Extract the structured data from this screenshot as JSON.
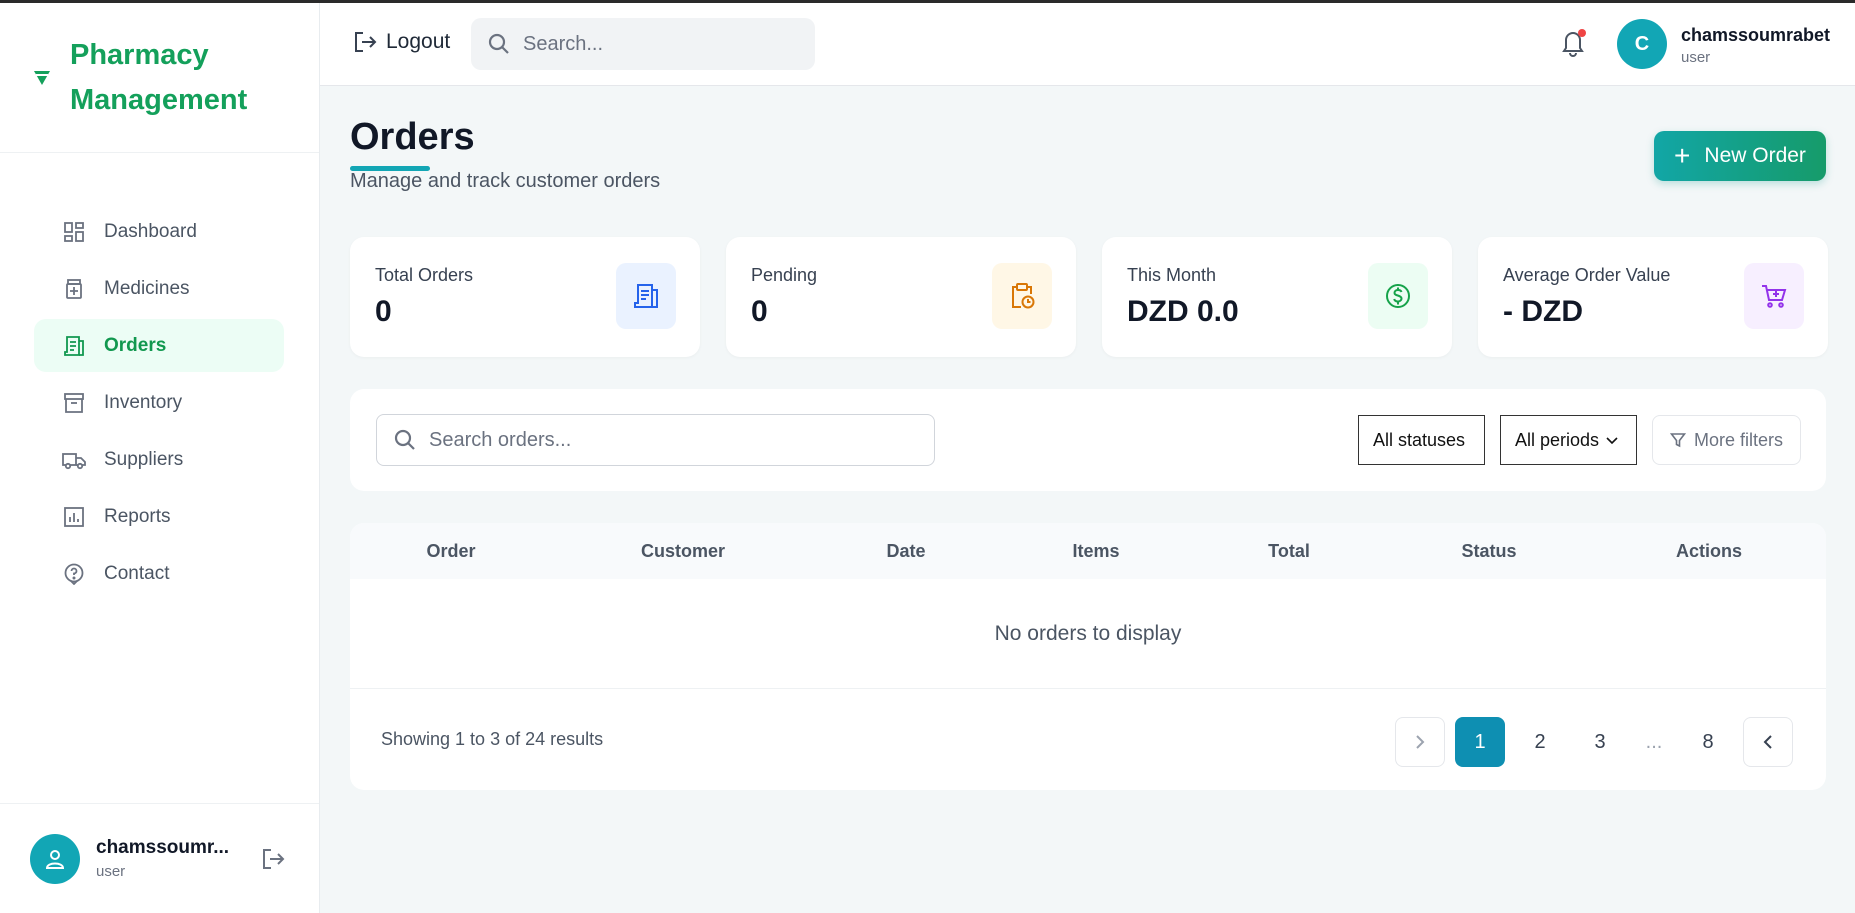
{
  "app": {
    "brand": "Pharmacy Management"
  },
  "sidebar": {
    "items": [
      {
        "label": "Dashboard",
        "icon": "dashboard-icon"
      },
      {
        "label": "Medicines",
        "icon": "medicine-icon"
      },
      {
        "label": "Orders",
        "icon": "receipt-icon",
        "active": true
      },
      {
        "label": "Inventory",
        "icon": "archive-icon"
      },
      {
        "label": "Suppliers",
        "icon": "truck-icon"
      },
      {
        "label": "Reports",
        "icon": "chart-icon"
      },
      {
        "label": "Contact",
        "icon": "help-icon"
      }
    ],
    "footer": {
      "name": "chamssoumr...",
      "role": "user"
    }
  },
  "header": {
    "logout_label": "Logout",
    "search_placeholder": "Search...",
    "avatar_initial": "C",
    "user_name": "chamssoumrabet",
    "user_role": "user"
  },
  "page": {
    "title": "Orders",
    "subtitle": "Manage and track customer orders",
    "new_order_label": "New Order"
  },
  "stats": [
    {
      "label": "Total Orders",
      "value": "0",
      "icon": "receipt-icon",
      "bg": "#eaf2ff",
      "fg": "#2563eb"
    },
    {
      "label": "Pending",
      "value": "0",
      "icon": "clipboard-clock-icon",
      "bg": "#fff7e6",
      "fg": "#d97706"
    },
    {
      "label": "This Month",
      "value": "DZD 0.0",
      "icon": "dollar-icon",
      "bg": "#ecfdf3",
      "fg": "#16a34a"
    },
    {
      "label": "Average Order Value",
      "value": "- DZD",
      "icon": "cart-icon",
      "bg": "#f7efff",
      "fg": "#9333ea"
    }
  ],
  "filters": {
    "search_placeholder": "Search orders...",
    "status_value": "All statuses",
    "period_value": "All periods",
    "more_filters_label": "More filters"
  },
  "table": {
    "columns": [
      "Order",
      "Customer",
      "Date",
      "Items",
      "Total",
      "Status",
      "Actions"
    ],
    "empty_message": "No orders to display"
  },
  "pagination": {
    "showing_text": "Showing 1 to 3 of 24 results",
    "pages": [
      "1",
      "2",
      "3",
      "...",
      "8"
    ],
    "current": "1"
  },
  "colors": {
    "brand": "#14a05b",
    "accent": "#12a6b5",
    "active_page": "#0e8fb2"
  }
}
